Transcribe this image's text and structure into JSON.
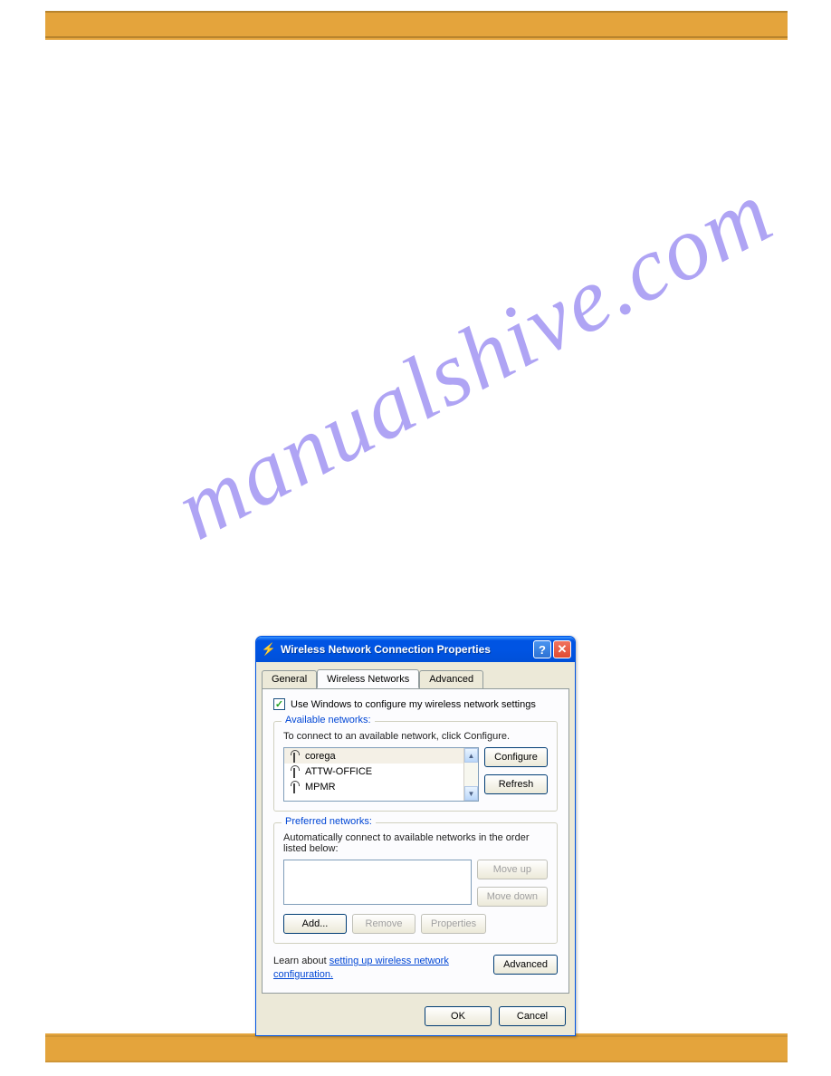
{
  "watermark": "manualshive.com",
  "dialog": {
    "title": "Wireless Network Connection Properties",
    "tabs": {
      "general": "General",
      "wireless": "Wireless Networks",
      "advanced": "Advanced"
    },
    "checkbox_label": "Use Windows to configure my wireless network settings",
    "available": {
      "legend": "Available networks:",
      "hint": "To connect to an available network, click Configure.",
      "items": [
        "corega",
        "ATTW-OFFICE",
        "MPMR"
      ],
      "configure_btn": "Configure",
      "refresh_btn": "Refresh"
    },
    "preferred": {
      "legend": "Preferred networks:",
      "hint": "Automatically connect to available networks in the order listed below:",
      "move_up_btn": "Move up",
      "move_down_btn": "Move down",
      "add_btn": "Add...",
      "remove_btn": "Remove",
      "properties_btn": "Properties"
    },
    "learn_prefix": "Learn about ",
    "learn_link": "setting up wireless network configuration.",
    "advanced_btn": "Advanced",
    "ok_btn": "OK",
    "cancel_btn": "Cancel"
  }
}
